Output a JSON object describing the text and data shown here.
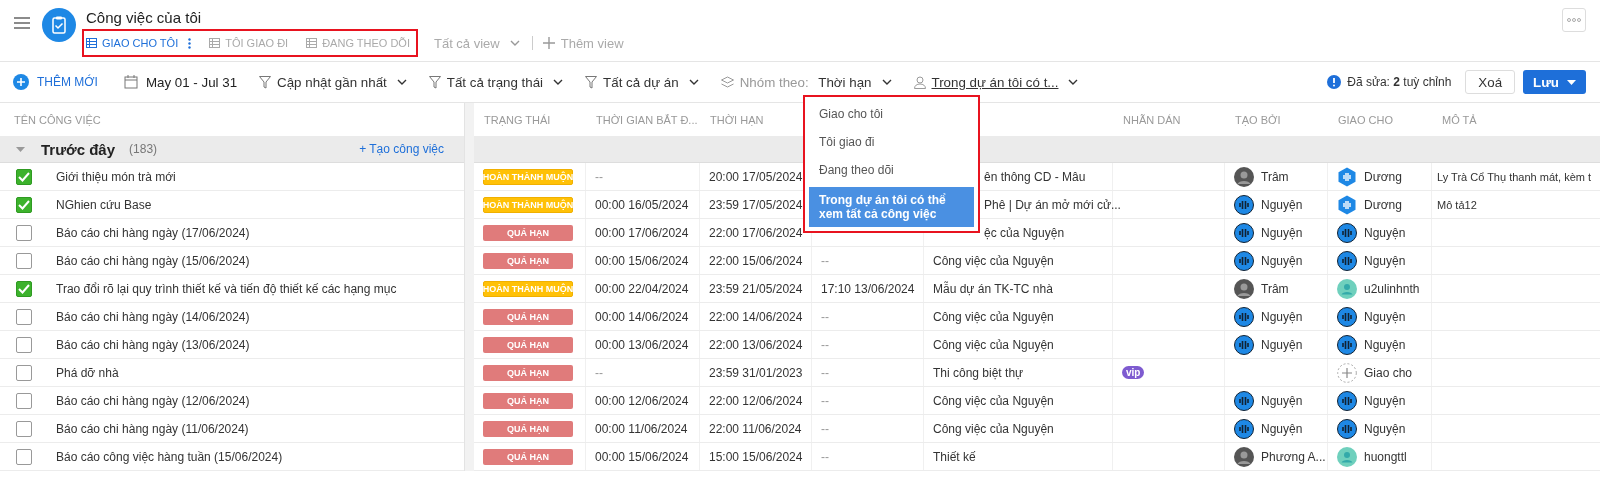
{
  "header": {
    "title": "Công việc của tôi",
    "views": [
      {
        "label": "GIAO CHO TÔI",
        "selected": true
      },
      {
        "label": "TÔI GIAO ĐI",
        "selected": false
      },
      {
        "label": "ĐANG THEO DÕI",
        "selected": false
      }
    ],
    "all_views": "Tất cả view",
    "add_view": "Thêm view"
  },
  "toolbar": {
    "add": "THÊM MỚI",
    "date_range": "May 01 - Jul 31",
    "filters": [
      "Cập nhật gần nhất",
      "Tất cả trạng thái",
      "Tất cả dự án"
    ],
    "group_by": {
      "label": "Nhóm theo:",
      "value": "Thời hạn"
    },
    "scope": "Trong dự án tôi có t...",
    "edited": "Đã sửa: **2** tuỳ chỉnh",
    "clear": "Xoá",
    "save": "Lưu"
  },
  "menu": [
    {
      "label": "Giao cho tôi",
      "selected": false
    },
    {
      "label": "Tôi giao đi",
      "selected": false
    },
    {
      "label": "Đang theo dõi",
      "selected": false
    },
    {
      "label": "Trong dự án tôi có thể xem tất cả công việc",
      "selected": true
    }
  ],
  "table": {
    "name_column": "TÊN CÔNG VIỆC",
    "columns": [
      "TRẠNG THÁI",
      "THỜI GIAN BẮT Đ...",
      "THỜI HẠN",
      null,
      null,
      "NHÃN DÁN",
      "TẠO BỞI",
      "GIAO CHO",
      "MÔ TẢ"
    ],
    "group": {
      "title": "Trước đây",
      "count": "(183)",
      "add_task": "+ Tạo công việc"
    },
    "rows": [
      {
        "checked": true,
        "name": "Giới thiệu món trà mới",
        "status": {
          "kind": "late",
          "text": "HOÀN THÀNH MUỘN"
        },
        "start": "--",
        "deadline": "20:00 17/05/2024",
        "column_4": null,
        "project": "ên thông CD - Mâu",
        "creator": {
          "kind": "photo",
          "name": "Trâm"
        },
        "assignee": {
          "kind": "hex",
          "name": "Dương"
        },
        "description": "Ly Trà Cổ Thụ thanh mát, kèm t"
      },
      {
        "checked": true,
        "name": "NGhien cứu Base",
        "status": {
          "kind": "late",
          "text": "HOÀN THÀNH MUỘN"
        },
        "start": "00:00 16/05/2024",
        "deadline": "23:59 17/05/2024",
        "column_4": null,
        "project": "Phê | Dự án mở mới cử...",
        "creator": {
          "kind": "logo",
          "name": "Nguyện"
        },
        "assignee": {
          "kind": "hex",
          "name": "Dương"
        },
        "description": "Mô tả12"
      },
      {
        "checked": false,
        "name": "Báo cáo chi hàng ngày (17/06/2024)",
        "status": {
          "kind": "overdue",
          "text": "QUÁ HẠN"
        },
        "start": "00:00 17/06/2024",
        "deadline": "22:00 17/06/2024",
        "column_4": null,
        "project": "ệc của Nguyện",
        "creator": {
          "kind": "logo",
          "name": "Nguyện"
        },
        "assignee": {
          "kind": "logo",
          "name": "Nguyện"
        }
      },
      {
        "checked": false,
        "name": "Báo cáo chi hàng ngày (15/06/2024)",
        "status": {
          "kind": "overdue",
          "text": "QUÁ HẠN"
        },
        "start": "00:00 15/06/2024",
        "deadline": "22:00 15/06/2024",
        "column_4": "--",
        "project": "Công việc của Nguyện",
        "creator": {
          "kind": "logo",
          "name": "Nguyện"
        },
        "assignee": {
          "kind": "logo",
          "name": "Nguyện"
        }
      },
      {
        "checked": true,
        "name": "Trao đổi rõ lại quy trình thiết kế và tiến độ thiết kế các hạng mục",
        "status": {
          "kind": "late",
          "text": "HOÀN THÀNH MUỘN"
        },
        "start": "00:00 22/04/2024",
        "deadline": "23:59 21/05/2024",
        "column_4": "17:10 13/06/2024",
        "project": "Mẫu dự án TK-TC nhà",
        "creator": {
          "kind": "photo",
          "name": "Trâm"
        },
        "assignee": {
          "kind": "user",
          "name": "u2ulinhnth"
        }
      },
      {
        "checked": false,
        "name": "Báo cáo chi hàng ngày (14/06/2024)",
        "status": {
          "kind": "overdue",
          "text": "QUÁ HẠN"
        },
        "start": "00:00 14/06/2024",
        "deadline": "22:00 14/06/2024",
        "column_4": "--",
        "project": "Công việc của Nguyện",
        "creator": {
          "kind": "logo",
          "name": "Nguyện"
        },
        "assignee": {
          "kind": "logo",
          "name": "Nguyện"
        }
      },
      {
        "checked": false,
        "name": "Báo cáo chi hàng ngày (13/06/2024)",
        "status": {
          "kind": "overdue",
          "text": "QUÁ HẠN"
        },
        "start": "00:00 13/06/2024",
        "deadline": "22:00 13/06/2024",
        "column_4": "--",
        "project": "Công việc của Nguyện",
        "creator": {
          "kind": "logo",
          "name": "Nguyện"
        },
        "assignee": {
          "kind": "logo",
          "name": "Nguyện"
        }
      },
      {
        "checked": false,
        "name": "Phá dỡ nhà",
        "status": {
          "kind": "overdue",
          "text": "QUÁ HẠN"
        },
        "start": "--",
        "deadline": "23:59 31/01/2023",
        "column_4": "--",
        "project": "Thi công biệt thự",
        "label": "vip",
        "assignee": {
          "kind": "add",
          "name": "Giao cho"
        }
      },
      {
        "checked": false,
        "name": "Báo cáo chi hàng ngày (12/06/2024)",
        "status": {
          "kind": "overdue",
          "text": "QUÁ HẠN"
        },
        "start": "00:00 12/06/2024",
        "deadline": "22:00 12/06/2024",
        "column_4": "--",
        "project": "Công việc của Nguyện",
        "creator": {
          "kind": "logo",
          "name": "Nguyện"
        },
        "assignee": {
          "kind": "logo",
          "name": "Nguyện"
        }
      },
      {
        "checked": false,
        "name": "Báo cáo chi hàng ngày (11/06/2024)",
        "status": {
          "kind": "overdue",
          "text": "QUÁ HẠN"
        },
        "start": "00:00 11/06/2024",
        "deadline": "22:00 11/06/2024",
        "column_4": "--",
        "project": "Công việc của Nguyện",
        "creator": {
          "kind": "logo",
          "name": "Nguyện"
        },
        "assignee": {
          "kind": "logo",
          "name": "Nguyện"
        }
      },
      {
        "checked": false,
        "name": "Báo cáo công việc hàng tuần (15/06/2024)",
        "status": {
          "kind": "overdue",
          "text": "QUÁ HẠN"
        },
        "start": "00:00 15/06/2024",
        "deadline": "15:00 15/06/2024",
        "column_4": "--",
        "project": "Thiết kế",
        "creator": {
          "kind": "photo",
          "name": "Phương A..."
        },
        "assignee": {
          "kind": "user",
          "name": "huongttl"
        }
      }
    ]
  }
}
